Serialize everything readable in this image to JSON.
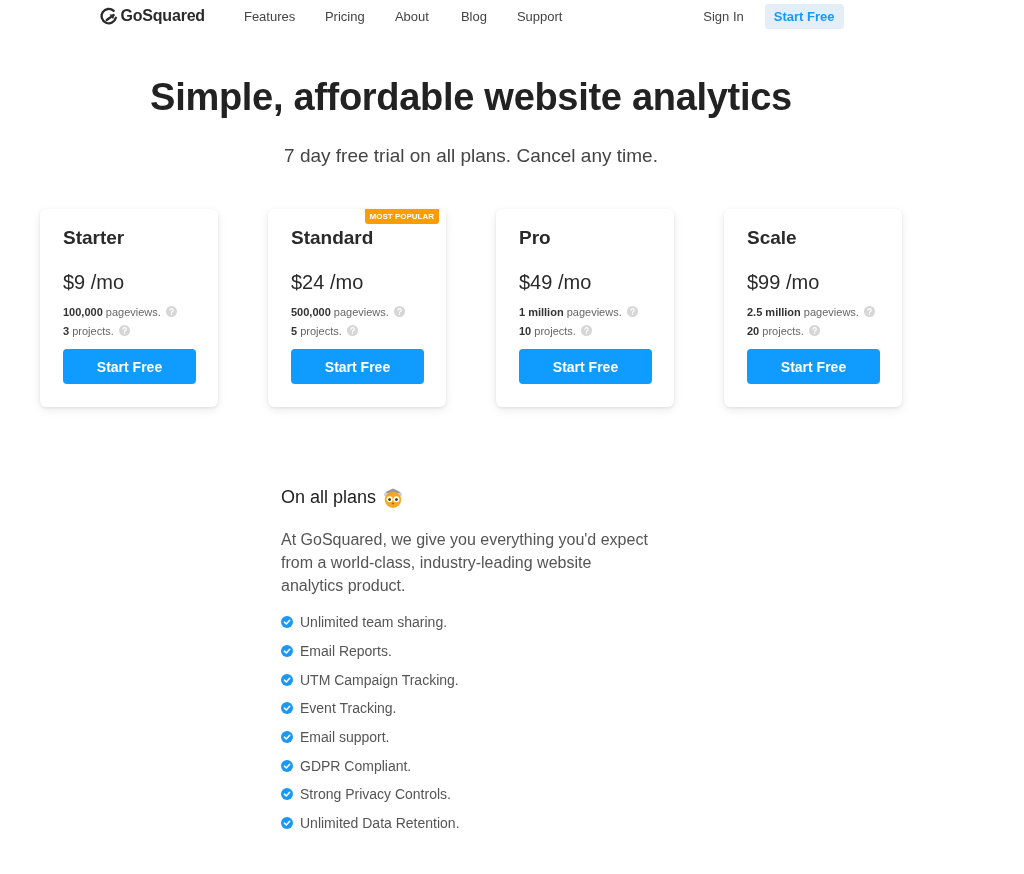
{
  "nav": {
    "logo": "GoSquared",
    "links": [
      {
        "label": "Features"
      },
      {
        "label": "Pricing"
      },
      {
        "label": "About"
      },
      {
        "label": "Blog"
      },
      {
        "label": "Support"
      }
    ],
    "sign_in": "Sign In",
    "cta": "Start Free"
  },
  "hero": {
    "title": "Simple, affordable website analytics",
    "subtitle": "7 day free trial on all plans. Cancel any time."
  },
  "plans": [
    {
      "name": "Starter",
      "price": "$9 /mo",
      "features": [
        "**100,000** pageviews.",
        "**3** projects."
      ],
      "button": "Start Free"
    },
    {
      "name": "Standard",
      "badge": "MOST POPULAR",
      "price": "$24 /mo",
      "features": [
        "**500,000** pageviews.",
        "**5** projects."
      ],
      "button": "Start Free"
    },
    {
      "name": "Pro",
      "price": "$49 /mo",
      "features": [
        "**1 million** pageviews.",
        "**10** projects."
      ],
      "button": "Start Free"
    },
    {
      "name": "Scale",
      "price": "$99 /mo",
      "features": [
        "**2.5 million** pageviews.",
        "**20** projects."
      ],
      "button": "Start Free"
    }
  ],
  "all_plans": {
    "heading": "On all plans",
    "text": "At GoSquared, we give you everything you'd expect from a world-class, industry-leading website analytics product.",
    "features": [
      "Unlimited team sharing.",
      "Email Reports.",
      "UTM Campaign Tracking.",
      "Event Tracking.",
      "Email support.",
      "GDPR Compliant.",
      "Strong Privacy Controls.",
      "Unlimited Data Retention."
    ]
  }
}
